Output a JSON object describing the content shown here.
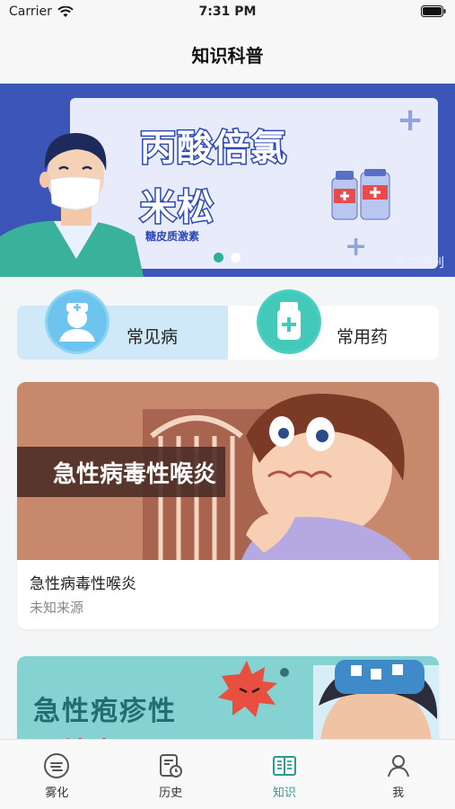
{
  "status_bar": {
    "carrier": "Carrier",
    "time": "7:31 PM"
  },
  "nav": {
    "title": "知识科普"
  },
  "banner": {
    "title_line1": "丙酸倍氯",
    "title_line2": "米松",
    "subtitle": "糖皮质激素",
    "source": "医学报刊",
    "page_count": 2,
    "active_page": 1
  },
  "categories": [
    {
      "label": "常见病",
      "icon": "doctor-icon",
      "active": true
    },
    {
      "label": "常用药",
      "icon": "medicine-bottle-icon",
      "active": false
    }
  ],
  "articles": [
    {
      "image_caption": "急性病毒性喉炎",
      "title": "急性病毒性喉炎",
      "source": "未知来源"
    },
    {
      "image_caption_line1": "急性疱疹性",
      "image_caption_line2": "咽峡炎"
    }
  ],
  "tabs": [
    {
      "label": "雾化",
      "icon": "nebulizer-icon",
      "active": false
    },
    {
      "label": "历史",
      "icon": "history-icon",
      "active": false
    },
    {
      "label": "知识",
      "icon": "book-icon",
      "active": true
    },
    {
      "label": "我",
      "icon": "user-icon",
      "active": false
    }
  ],
  "colors": {
    "accent": "#2a9d8f",
    "banner_bg": "#3c55b8",
    "category_active_bg": "#cfe9f9"
  }
}
